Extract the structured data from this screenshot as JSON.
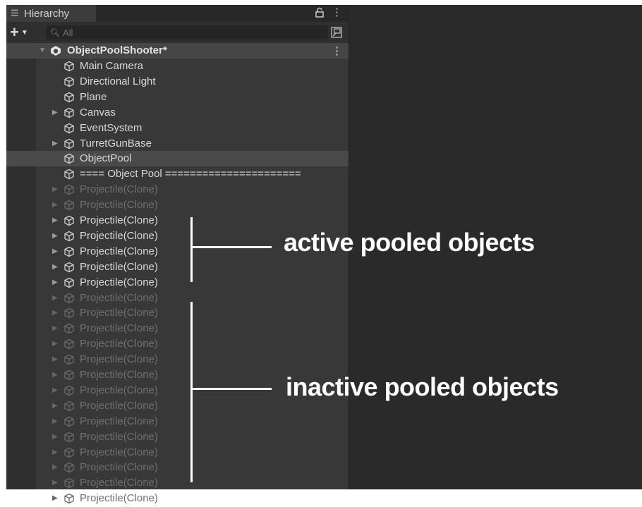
{
  "window": {
    "tab_label": "Hierarchy",
    "search_placeholder": "All"
  },
  "scene": {
    "name": "ObjectPoolShooter*"
  },
  "rows": [
    {
      "label": "Main Camera",
      "foldable": false,
      "active": true
    },
    {
      "label": "Directional Light",
      "foldable": false,
      "active": true
    },
    {
      "label": "Plane",
      "foldable": false,
      "active": true
    },
    {
      "label": "Canvas",
      "foldable": true,
      "active": true
    },
    {
      "label": "EventSystem",
      "foldable": false,
      "active": true
    },
    {
      "label": "TurretGunBase",
      "foldable": true,
      "active": true
    },
    {
      "label": "ObjectPool",
      "foldable": false,
      "active": true,
      "selected": true
    },
    {
      "label": "==== Object Pool ======================",
      "foldable": false,
      "active": true
    },
    {
      "label": "Projectile(Clone)",
      "foldable": true,
      "active": false
    },
    {
      "label": "Projectile(Clone)",
      "foldable": true,
      "active": false
    },
    {
      "label": "Projectile(Clone)",
      "foldable": true,
      "active": true
    },
    {
      "label": "Projectile(Clone)",
      "foldable": true,
      "active": true
    },
    {
      "label": "Projectile(Clone)",
      "foldable": true,
      "active": true
    },
    {
      "label": "Projectile(Clone)",
      "foldable": true,
      "active": true
    },
    {
      "label": "Projectile(Clone)",
      "foldable": true,
      "active": true
    },
    {
      "label": "Projectile(Clone)",
      "foldable": true,
      "active": false
    },
    {
      "label": "Projectile(Clone)",
      "foldable": true,
      "active": false
    },
    {
      "label": "Projectile(Clone)",
      "foldable": true,
      "active": false
    },
    {
      "label": "Projectile(Clone)",
      "foldable": true,
      "active": false
    },
    {
      "label": "Projectile(Clone)",
      "foldable": true,
      "active": false
    },
    {
      "label": "Projectile(Clone)",
      "foldable": true,
      "active": false
    },
    {
      "label": "Projectile(Clone)",
      "foldable": true,
      "active": false
    },
    {
      "label": "Projectile(Clone)",
      "foldable": true,
      "active": false
    },
    {
      "label": "Projectile(Clone)",
      "foldable": true,
      "active": false
    },
    {
      "label": "Projectile(Clone)",
      "foldable": true,
      "active": false
    },
    {
      "label": "Projectile(Clone)",
      "foldable": true,
      "active": false
    },
    {
      "label": "Projectile(Clone)",
      "foldable": true,
      "active": false
    },
    {
      "label": "Projectile(Clone)",
      "foldable": true,
      "active": false
    },
    {
      "label": "Projectile(Clone)",
      "foldable": true,
      "active": false
    }
  ],
  "annotations": {
    "active": "active pooled objects",
    "inactive": "inactive pooled objects"
  },
  "icons": {
    "tab": "hierarchy-list-icon",
    "lock": "lock-icon",
    "menu": "kebab-menu-icon",
    "create": "plus-icon",
    "search": "search-icon",
    "scene_filter": "scene-filter-icon",
    "scene": "unity-scene-icon",
    "object": "gameobject-cube-icon"
  },
  "colors": {
    "active_text": "#d8d8d8",
    "inactive_text": "#6f6f6f",
    "annotation": "#ffffff"
  }
}
